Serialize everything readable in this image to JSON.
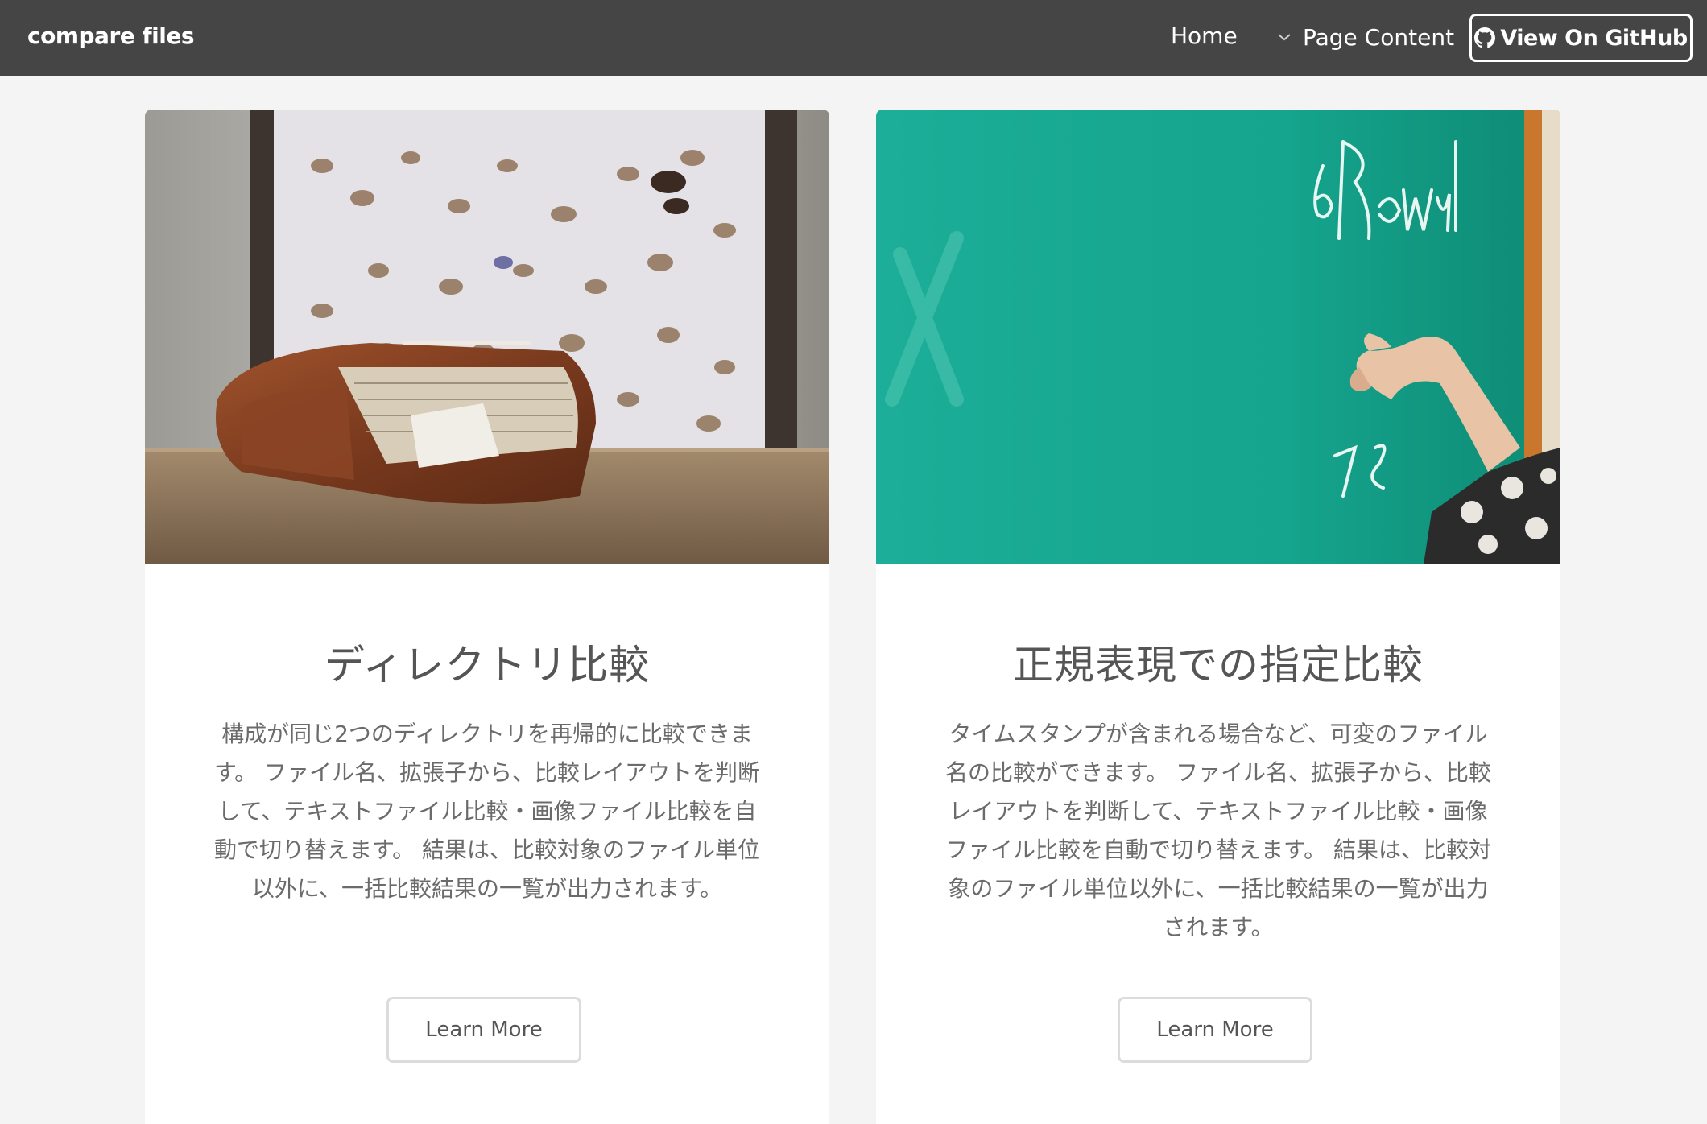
{
  "navbar": {
    "brand": "compare files",
    "home_label": "Home",
    "page_content_label": "Page Content",
    "github_label": "View On GitHub"
  },
  "cards": [
    {
      "image_name": "notebook-butterflies-photo",
      "title": "ディレクトリ比較",
      "description": "構成が同じ2つのディレクトリを再帰的に比較できます。 ファイル名、拡張子から、比較レイアウトを判断して、テキストファイル比較・画像ファイル比較を自動で切り替えます。 結果は、比較対象のファイル単位以外に、一括比較結果の一覧が出力されます。",
      "button_label": "Learn More"
    },
    {
      "image_name": "chalkboard-hand-photo",
      "title": "正規表現での指定比較",
      "description": "タイムスタンプが含まれる場合など、可変のファイル名の比較ができます。 ファイル名、拡張子から、比較レイアウトを判断して、テキストファイル比較・画像ファイル比較を自動で切り替えます。 結果は、比較対象のファイル単位以外に、一括比較結果の一覧が出力されます。",
      "button_label": "Learn More"
    }
  ],
  "colors": {
    "navbar_bg": "#454545",
    "page_bg": "#f4f4f4",
    "card_bg": "#ffffff",
    "chalkboard": "#16a58e"
  }
}
